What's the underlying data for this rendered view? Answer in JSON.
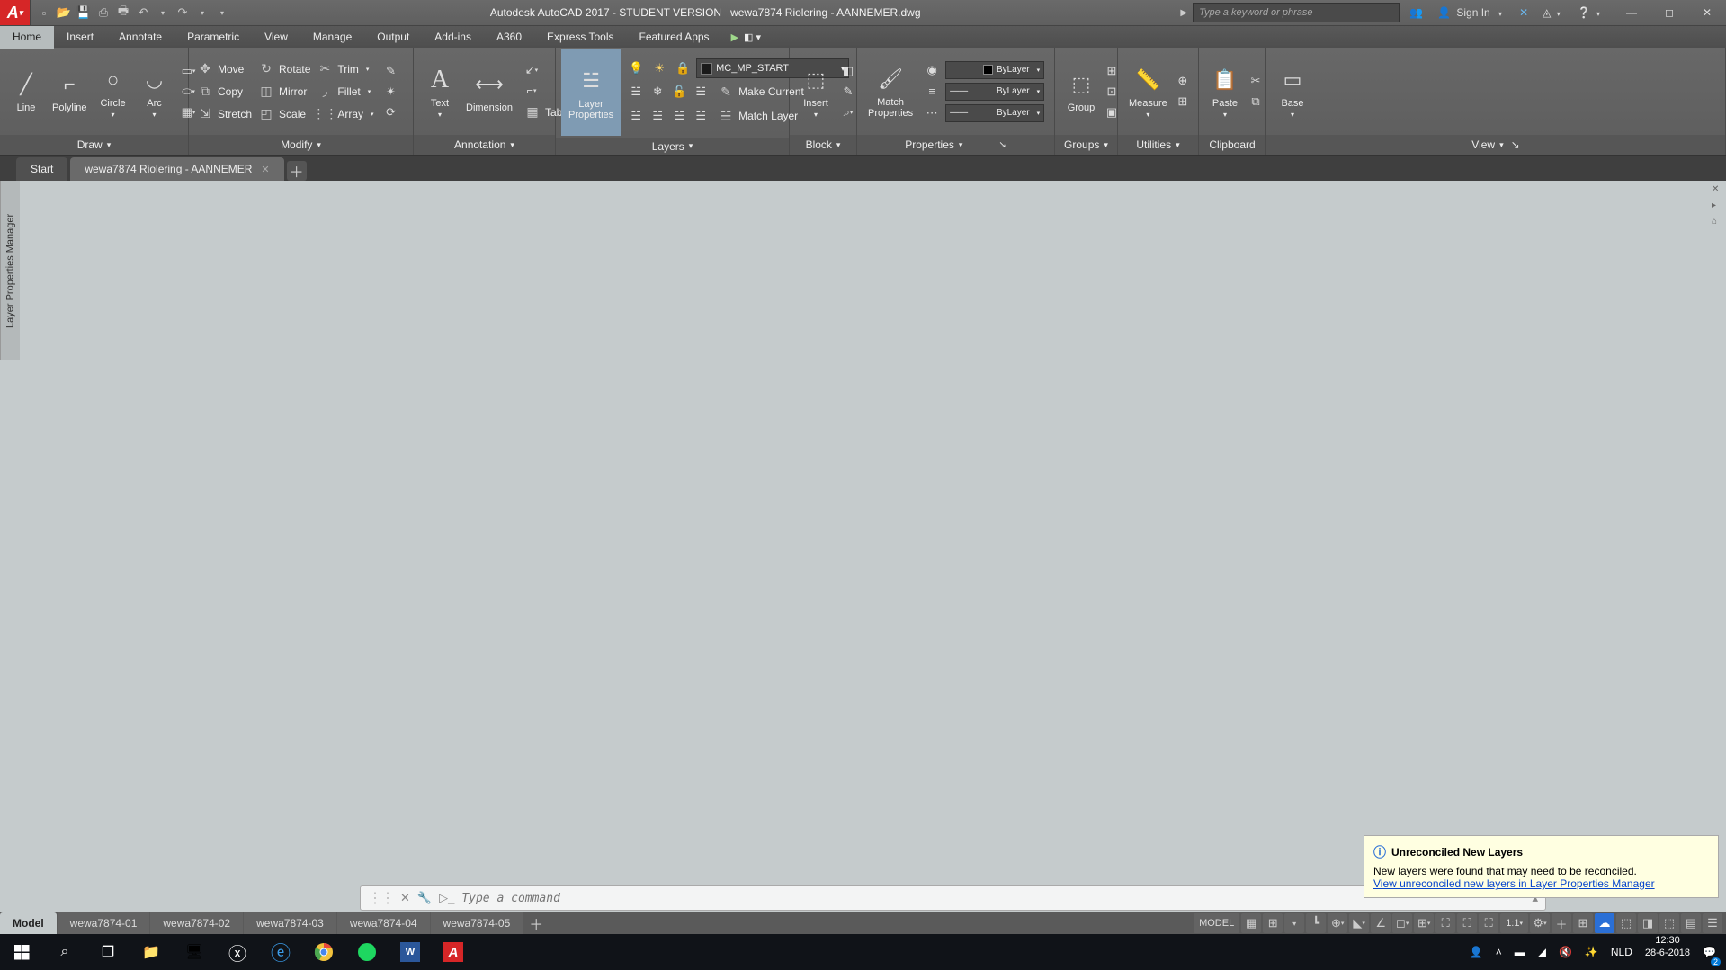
{
  "title": {
    "app": "Autodesk AutoCAD 2017 - STUDENT VERSION",
    "doc": "wewa7874 Riolering - AANNEMER.dwg",
    "search_placeholder": "Type a keyword or phrase",
    "signin": "Sign In"
  },
  "menu": [
    "Home",
    "Insert",
    "Annotate",
    "Parametric",
    "View",
    "Manage",
    "Output",
    "Add-ins",
    "A360",
    "Express Tools",
    "Featured Apps"
  ],
  "ribbon": {
    "draw": {
      "line": "Line",
      "polyline": "Polyline",
      "circle": "Circle",
      "arc": "Arc",
      "label": "Draw"
    },
    "modify": {
      "move": "Move",
      "rotate": "Rotate",
      "trim": "Trim",
      "copy": "Copy",
      "mirror": "Mirror",
      "fillet": "Fillet",
      "stretch": "Stretch",
      "scale": "Scale",
      "array": "Array",
      "label": "Modify"
    },
    "annotation": {
      "text": "Text",
      "dimension": "Dimension",
      "table": "Table",
      "label": "Annotation"
    },
    "layers": {
      "layer_props": "Layer\nProperties",
      "current": "MC_MP_START",
      "make_current": "Make Current",
      "match": "Match Layer",
      "label": "Layers"
    },
    "block": {
      "insert": "Insert",
      "label": "Block"
    },
    "properties": {
      "match": "Match\nProperties",
      "bylayer": "ByLayer",
      "label": "Properties"
    },
    "groups": {
      "group": "Group",
      "label": "Groups"
    },
    "utilities": {
      "measure": "Measure",
      "label": "Utilities"
    },
    "clipboard": {
      "paste": "Paste",
      "label": "Clipboard"
    },
    "view": {
      "base": "Base",
      "label": "View"
    }
  },
  "filetabs": {
    "start": "Start",
    "doc": "wewa7874 Riolering - AANNEMER"
  },
  "vtab": "Layer Properties Manager",
  "command": {
    "placeholder": "Type a command"
  },
  "notification": {
    "title": "Unreconciled New Layers",
    "body": "New layers were found that may need to be reconciled.",
    "link": "View unreconciled new layers in Layer Properties Manager"
  },
  "layouts": {
    "model": "Model",
    "tabs": [
      "wewa7874-01",
      "wewa7874-02",
      "wewa7874-03",
      "wewa7874-04",
      "wewa7874-05"
    ]
  },
  "status": {
    "model": "MODEL",
    "scale": "1:1"
  },
  "taskbar": {
    "lang": "NLD",
    "time": "12:30",
    "date": "28-6-2018",
    "notif": "2"
  }
}
